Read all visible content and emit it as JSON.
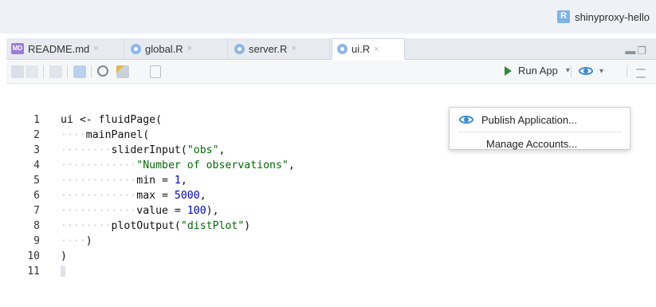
{
  "header": {
    "project_name": "shinyproxy-hello",
    "project_icon": "r-project-icon"
  },
  "tabs": [
    {
      "label": "README.md",
      "icon": "markdown-file-icon",
      "active": false
    },
    {
      "label": "global.R",
      "icon": "r-file-icon",
      "active": false
    },
    {
      "label": "server.R",
      "icon": "r-file-icon",
      "active": false
    },
    {
      "label": "ui.R",
      "icon": "r-file-icon",
      "active": true
    }
  ],
  "tab_close_glyph": "×",
  "toolbar": {
    "run_app_label": "Run App",
    "run_caret": "▾",
    "publish_caret": "▾"
  },
  "publish_menu": {
    "items": [
      {
        "label": "Publish Application...",
        "icon": "publish-icon"
      },
      {
        "label": "Manage Accounts..."
      }
    ]
  },
  "editor": {
    "line_numbers": [
      "1",
      "2",
      "3",
      "4",
      "5",
      "6",
      "7",
      "8",
      "9",
      "10",
      "11"
    ],
    "lines": [
      {
        "dots": "",
        "code": "ui <- fluidPage("
      },
      {
        "dots": "····",
        "code": "mainPanel("
      },
      {
        "dots": "········",
        "code_pre": "sliderInput(",
        "str": "\"obs\"",
        "code_post": ","
      },
      {
        "dots": "············",
        "str": "\"Number of observations\"",
        "code_post": ","
      },
      {
        "dots": "············",
        "code_pre": "min = ",
        "num": "1",
        "code_post": ","
      },
      {
        "dots": "············",
        "code_pre": "max = ",
        "num": "5000",
        "code_post": ","
      },
      {
        "dots": "············",
        "code_pre": "value = ",
        "num": "100",
        "code_post": "),"
      },
      {
        "dots": "········",
        "code_pre": "plotOutput(",
        "str": "\"distPlot\"",
        "code_post": ")"
      },
      {
        "dots": "····",
        "code": ")"
      },
      {
        "dots": "",
        "code": ")"
      },
      {
        "dots": "",
        "code": ""
      }
    ]
  },
  "colors": {
    "string": "#036a07",
    "number": "#0000cd",
    "accent": "#3a8bd1",
    "run_green": "#2e8b3e"
  }
}
